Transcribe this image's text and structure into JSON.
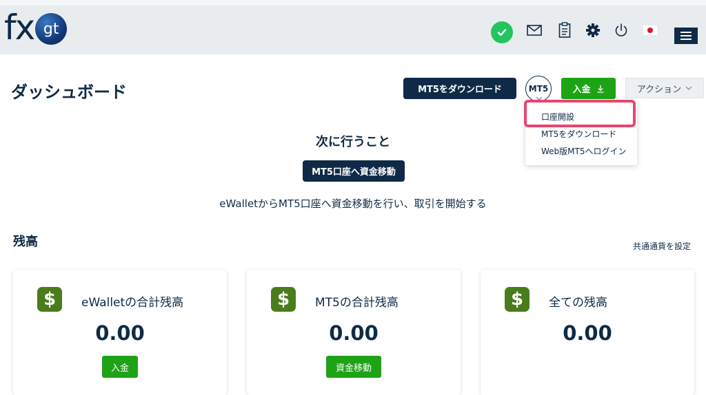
{
  "header": {
    "logo_fx": "fx",
    "logo_gt": "gt",
    "icons": [
      "check-circle-icon",
      "mail-icon",
      "clipboard-icon",
      "gear-icon",
      "power-icon",
      "flag-jp-icon",
      "menu-icon"
    ]
  },
  "page": {
    "title": "ダッシュボード",
    "download_mt5_label": "MT5をダウンロード",
    "mt5_badge": "MT5",
    "deposit_label": "入金",
    "action_label": "アクション"
  },
  "mt5_menu": {
    "items": [
      "口座開設",
      "MT5をダウンロード",
      "Web版MT5へログイン"
    ],
    "highlighted_index": 0
  },
  "next_steps": {
    "title": "次に行うこと",
    "button_label": "MT5口座へ資金移動",
    "description": "eWalletからMT5口座へ資金移動を行い、取引を開始する"
  },
  "balance": {
    "title": "残高",
    "currency_link": "共通通貨を設定",
    "cards": [
      {
        "label": "eWalletの合計残高",
        "amount": "0.00",
        "button": "入金"
      },
      {
        "label": "MT5の合計残高",
        "amount": "0.00",
        "button": "資金移動"
      },
      {
        "label": "全ての残高",
        "amount": "0.00",
        "button": ""
      }
    ],
    "dollar_symbol": "$"
  },
  "colors": {
    "navy": "#0e2a47",
    "green": "#1ea316",
    "highlight": "#e8456f",
    "status_green": "#22c55e"
  }
}
